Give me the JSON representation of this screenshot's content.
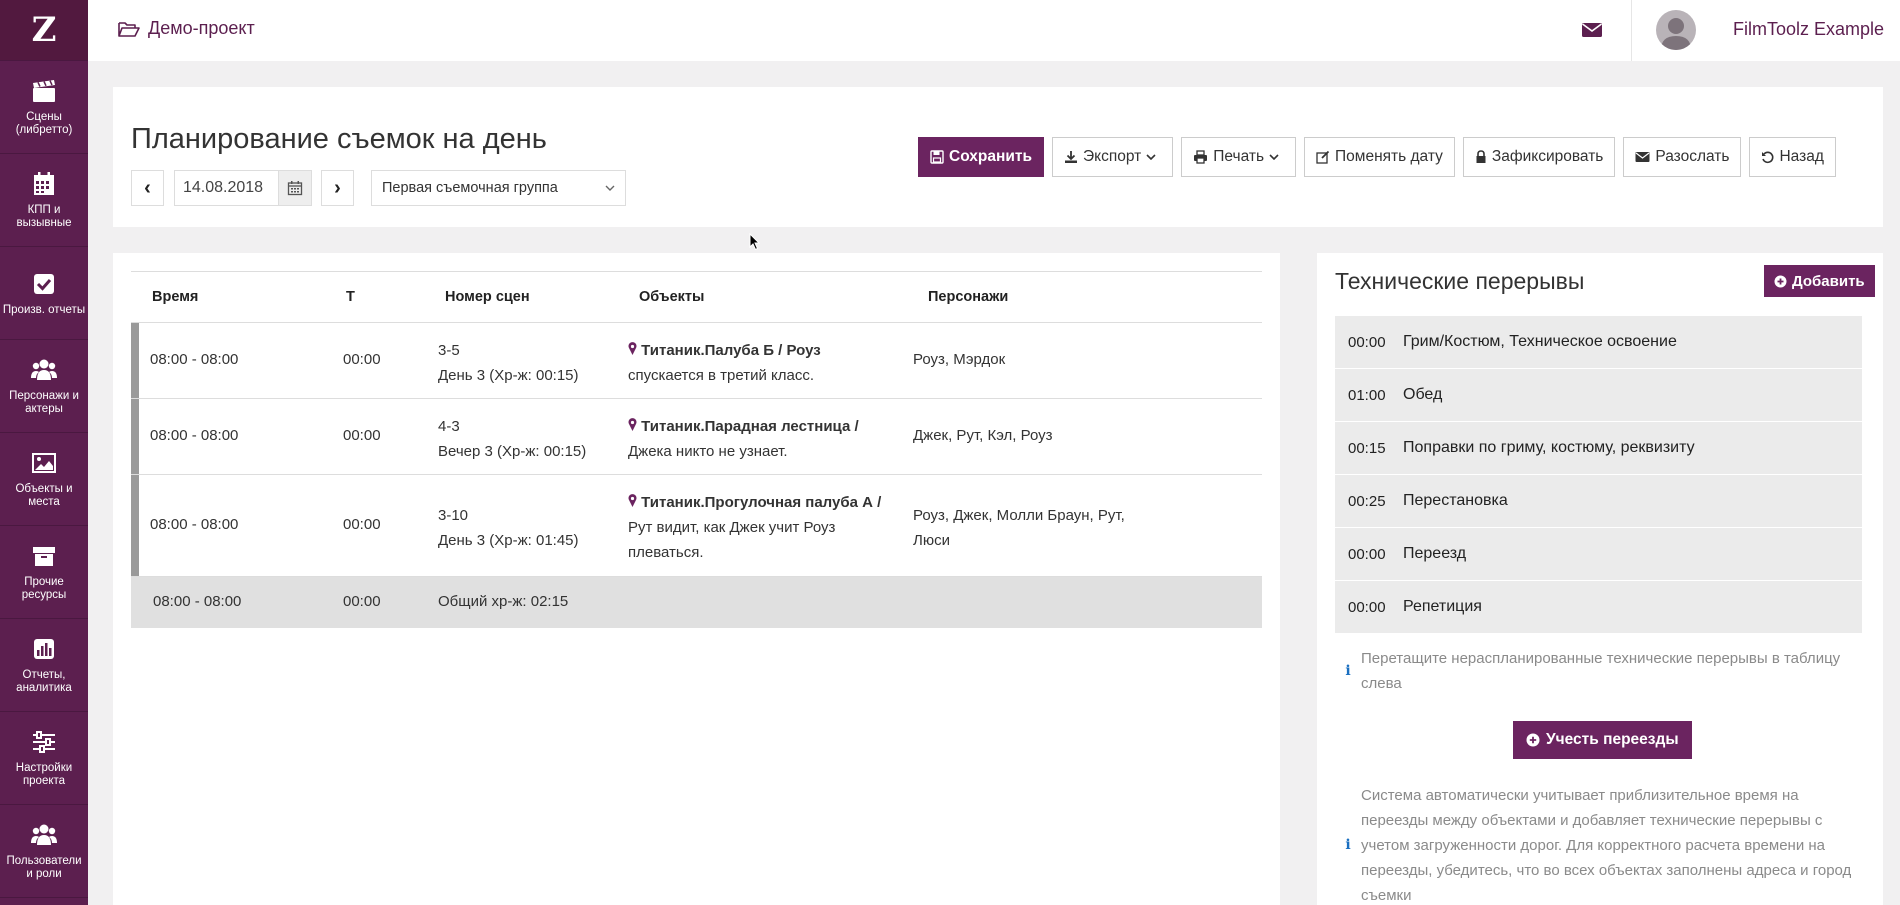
{
  "app": {
    "logo": "Z"
  },
  "sidebar": {
    "items": [
      {
        "label": "Сцены (либретто)",
        "icon": "clapperboard-icon"
      },
      {
        "label": "КПП и вызывные",
        "icon": "calendar-icon"
      },
      {
        "label": "Произв. отчеты",
        "icon": "checkbox-icon"
      },
      {
        "label": "Персонажи и актеры",
        "icon": "users-icon"
      },
      {
        "label": "Объекты и места",
        "icon": "image-icon"
      },
      {
        "label": "Прочие ресурсы",
        "icon": "archive-icon"
      },
      {
        "label": "Отчеты, аналитика",
        "icon": "bar-chart-icon"
      },
      {
        "label": "Настройки проекта",
        "icon": "sliders-icon"
      },
      {
        "label": "Пользователи и роли",
        "icon": "users-icon"
      }
    ]
  },
  "topbar": {
    "project": "Демо-проект",
    "user": "FilmToolz Example"
  },
  "header": {
    "title": "Планирование съемок на день",
    "date": "14.08.2018",
    "group": "Первая съемочная группа",
    "buttons": {
      "save": "Сохранить",
      "export": "Экспорт",
      "print": "Печать",
      "change_date": "Поменять дату",
      "lock": "Зафиксировать",
      "send": "Разослать",
      "back": "Назад"
    }
  },
  "table": {
    "columns": {
      "time": "Время",
      "t": "Т",
      "scenes": "Номер сцен",
      "objects": "Объекты",
      "characters": "Персонажи"
    },
    "rows": [
      {
        "time": "08:00 - 08:00",
        "t": "00:00",
        "scene_no": "3-5",
        "scene_info": "День 3 (Хр-ж: 00:15)",
        "object_title": "Титаник.Палуба Б / Роуз",
        "object_desc": "спускается в третий класс.",
        "chars_line1": "Роуз, Мэрдок",
        "chars_line2": ""
      },
      {
        "time": "08:00 - 08:00",
        "t": "00:00",
        "scene_no": "4-3",
        "scene_info": "Вечер 3 (Хр-ж: 00:15)",
        "object_title": "Титаник.Парадная лестница /",
        "object_desc": "Джека никто не узнает.",
        "chars_line1": "Джек, Рут, Кэл, Роуз",
        "chars_line2": ""
      },
      {
        "time": "08:00 - 08:00",
        "t": "00:00",
        "scene_no": "3-10",
        "scene_info": "День 3 (Хр-ж: 01:45)",
        "object_title": "Титаник.Прогулочная палуба А /",
        "object_desc_1": "Рут видит, как Джек учит Роуз",
        "object_desc_2": "плеваться.",
        "chars_line1": "Роуз, Джек, Молли Браун, Рут,",
        "chars_line2": "Люси"
      }
    ],
    "total": {
      "time": "08:00 - 08:00",
      "t": "00:00",
      "label": "Общий хр-ж: 02:15"
    }
  },
  "breaks": {
    "title": "Технические перерывы",
    "add": "Добавить",
    "items": [
      {
        "time": "00:00",
        "name": "Грим/Костюм, Техническое освоение"
      },
      {
        "time": "01:00",
        "name": "Обед"
      },
      {
        "time": "00:15",
        "name": "Поправки по гриму, костюму, реквизиту"
      },
      {
        "time": "00:25",
        "name": "Перестановка"
      },
      {
        "time": "00:00",
        "name": "Переезд"
      },
      {
        "time": "00:00",
        "name": "Репетиция"
      }
    ],
    "hint_1": "Перетащите нераспланированные технические перерывы в таблицу",
    "hint_2": "слева",
    "account_btn": "Учесть переезды",
    "info_lines": [
      "Система автоматически учитывает приблизительное время на",
      "переезды между объектами и добавляет технические перерывы с",
      "учетом загруженности дорог. Для корректного расчета времени на",
      "переезды, убедитесь, что во всех объектах заполнены адреса и город",
      "съемки"
    ]
  },
  "colors": {
    "brand": "#5c1f4f",
    "button": "#6b2460",
    "info": "#1a6fc0"
  }
}
